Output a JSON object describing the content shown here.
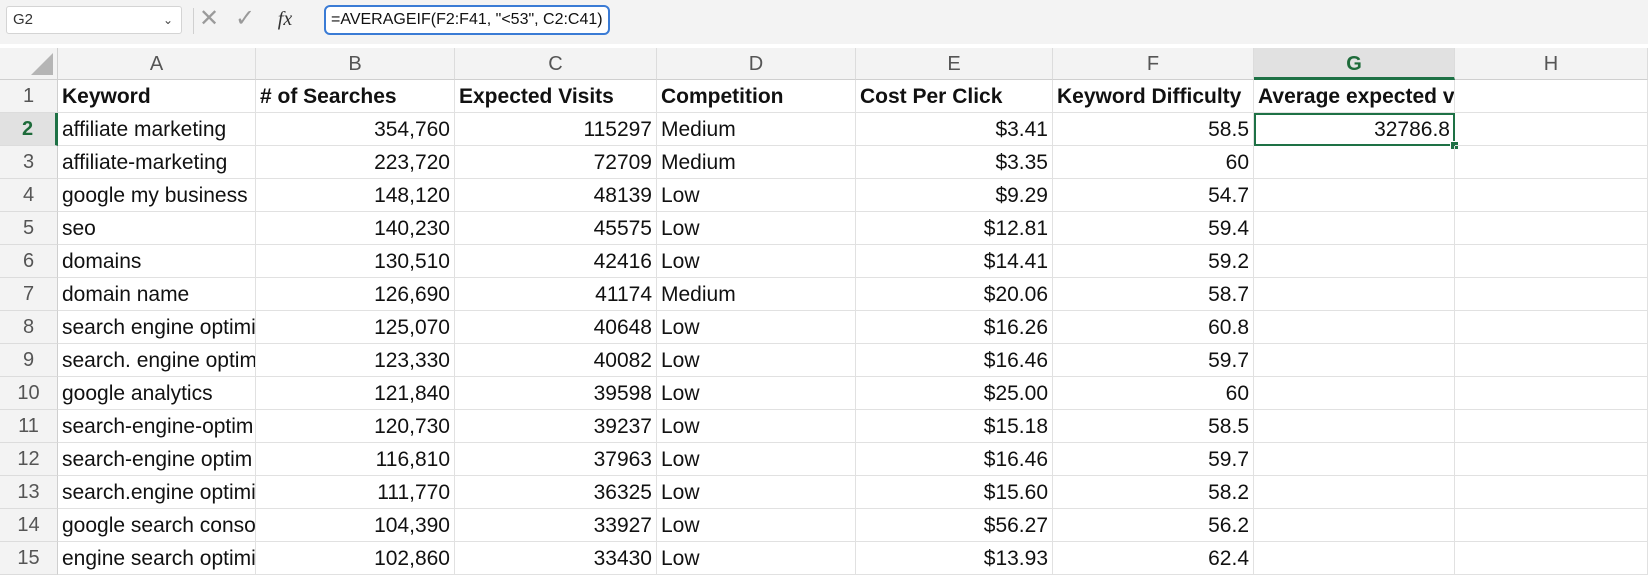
{
  "formula_bar": {
    "name_box": "G2",
    "cancel_icon": "✕",
    "enter_icon": "✓",
    "fx_label": "fx",
    "formula": "=AVERAGEIF(F2:F41, \"<53\", C2:C41)"
  },
  "columns": [
    "A",
    "B",
    "C",
    "D",
    "E",
    "F",
    "G",
    "H"
  ],
  "selected_column": "G",
  "selected_row": "2",
  "header_row": {
    "num": "1",
    "cells": [
      "Keyword",
      "# of Searches",
      "Expected Visits",
      "Competition",
      "Cost Per Click",
      "Keyword Difficulty",
      "Average expected visits-low KD",
      ""
    ]
  },
  "rows": [
    {
      "num": "2",
      "keyword": "affiliate marketing",
      "searches": "354,760",
      "visits": "115297",
      "competition": "Medium",
      "cpc": "$3.41",
      "kd": "58.5",
      "avg": "32786.8"
    },
    {
      "num": "3",
      "keyword": "affiliate-marketing",
      "searches": "223,720",
      "visits": "72709",
      "competition": "Medium",
      "cpc": "$3.35",
      "kd": "60",
      "avg": ""
    },
    {
      "num": "4",
      "keyword": "google my business",
      "searches": "148,120",
      "visits": "48139",
      "competition": "Low",
      "cpc": "$9.29",
      "kd": "54.7",
      "avg": ""
    },
    {
      "num": "5",
      "keyword": "seo",
      "searches": "140,230",
      "visits": "45575",
      "competition": "Low",
      "cpc": "$12.81",
      "kd": "59.4",
      "avg": ""
    },
    {
      "num": "6",
      "keyword": "domains",
      "searches": "130,510",
      "visits": "42416",
      "competition": "Low",
      "cpc": "$14.41",
      "kd": "59.2",
      "avg": ""
    },
    {
      "num": "7",
      "keyword": "domain name",
      "searches": "126,690",
      "visits": "41174",
      "competition": "Medium",
      "cpc": "$20.06",
      "kd": "58.7",
      "avg": ""
    },
    {
      "num": "8",
      "keyword": "search engine optimi",
      "searches": "125,070",
      "visits": "40648",
      "competition": "Low",
      "cpc": "$16.26",
      "kd": "60.8",
      "avg": ""
    },
    {
      "num": "9",
      "keyword": "search. engine optim",
      "searches": "123,330",
      "visits": "40082",
      "competition": "Low",
      "cpc": "$16.46",
      "kd": "59.7",
      "avg": ""
    },
    {
      "num": "10",
      "keyword": "google analytics",
      "searches": "121,840",
      "visits": "39598",
      "competition": "Low",
      "cpc": "$25.00",
      "kd": "60",
      "avg": ""
    },
    {
      "num": "11",
      "keyword": "search-engine-optim",
      "searches": "120,730",
      "visits": "39237",
      "competition": "Low",
      "cpc": "$15.18",
      "kd": "58.5",
      "avg": ""
    },
    {
      "num": "12",
      "keyword": "search-engine optim",
      "searches": "116,810",
      "visits": "37963",
      "competition": "Low",
      "cpc": "$16.46",
      "kd": "59.7",
      "avg": ""
    },
    {
      "num": "13",
      "keyword": "search.engine optimi",
      "searches": "111,770",
      "visits": "36325",
      "competition": "Low",
      "cpc": "$15.60",
      "kd": "58.2",
      "avg": ""
    },
    {
      "num": "14",
      "keyword": "google search consol",
      "searches": "104,390",
      "visits": "33927",
      "competition": "Low",
      "cpc": "$56.27",
      "kd": "56.2",
      "avg": ""
    },
    {
      "num": "15",
      "keyword": "engine search optimi",
      "searches": "102,860",
      "visits": "33430",
      "competition": "Low",
      "cpc": "$13.93",
      "kd": "62.4",
      "avg": ""
    }
  ],
  "colors": {
    "selection": "#1e7145",
    "formula_border": "#3a7bd5",
    "header_bg": "#f3f3f3"
  }
}
